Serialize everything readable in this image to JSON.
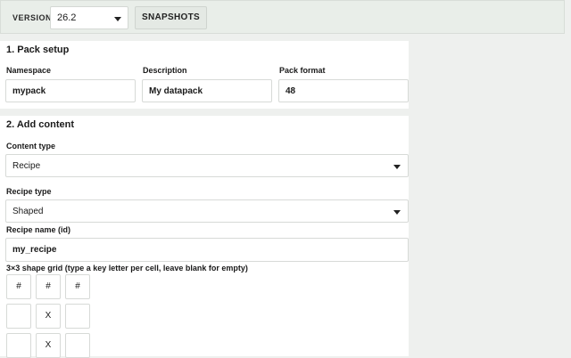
{
  "toolbar": {
    "version_label": "VERSION",
    "version_value": "26.2",
    "snapshots_label": "SNAPSHOTS"
  },
  "pack_setup": {
    "title": "1. Pack setup",
    "namespace_label": "Namespace",
    "namespace_value": "mypack",
    "description_label": "Description",
    "description_value": "My datapack",
    "format_label": "Pack format",
    "format_value": "48"
  },
  "add_content": {
    "title": "2. Add content",
    "content_type_label": "Content type",
    "content_type_value": "Recipe",
    "recipe_type_label": "Recipe type",
    "recipe_type_value": "Shaped",
    "recipe_name_label": "Recipe name (id)",
    "recipe_name_value": "my_recipe",
    "grid_label": "3×3 shape grid (type a key letter per cell, leave blank for empty)",
    "grid": [
      [
        "#",
        "#",
        "#"
      ],
      [
        "",
        "X",
        ""
      ],
      [
        "",
        "X",
        ""
      ]
    ]
  }
}
